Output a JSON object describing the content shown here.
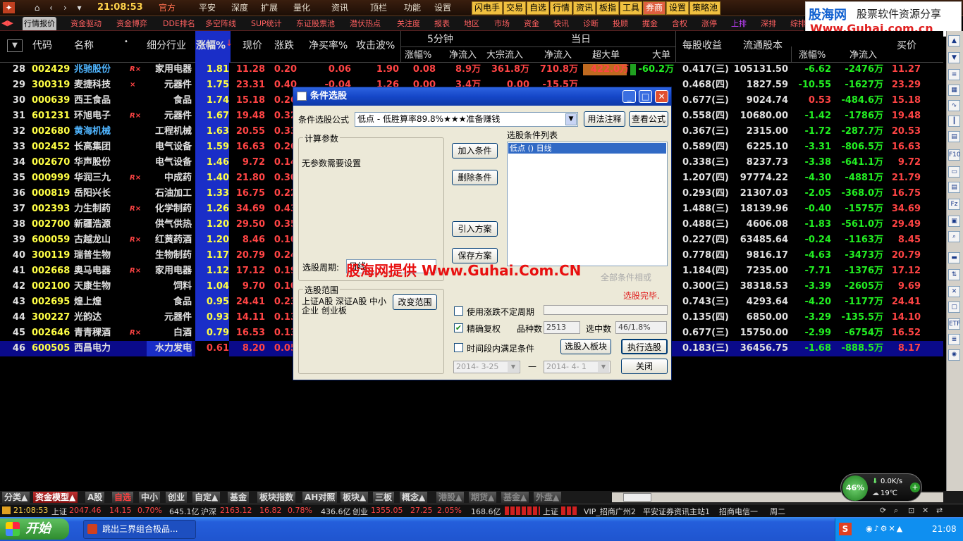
{
  "topbar": {
    "clock": "21:08:53",
    "menu": [
      "官方",
      "平安",
      "深度",
      "扩展",
      "量化",
      "资讯",
      "顶栏",
      "功能",
      "设置"
    ],
    "buttons": [
      "闪电手",
      "交易",
      "自选",
      "行情",
      "资讯",
      "板指",
      "工具",
      "券商",
      "设置",
      "策略池"
    ],
    "logo_top": "股海网",
    "logo_tag": "股票软件资源分享",
    "logo_url": "Www.Guhai.com.cn"
  },
  "tabs": [
    "行情报价",
    "资金驱动",
    "资金博弈",
    "DDE排名",
    "多空阵线",
    "SUP统计",
    "东证股票池",
    "潜伏热点",
    "关注度",
    "报表",
    "地区",
    "市场",
    "资金",
    "快讯",
    "诊断",
    "投顾",
    "掘金",
    "含权",
    "涨停",
    "上排",
    "深排",
    "综排"
  ],
  "header": {
    "code": "代码",
    "name": "名称",
    "industry": "细分行业",
    "pct": "涨幅%",
    "price": "现价",
    "change": "涨跌",
    "net_buy": "净买率%",
    "attack": "攻击波%",
    "five_min": "5分钟",
    "five_pct": "涨幅%",
    "five_flow": "净流入",
    "day": "当日",
    "big_flow": "大宗流入",
    "day_flow": "净流入",
    "super_big": "超大单",
    "big": "大单",
    "eps": "每股收益",
    "float_cap": "流通股本",
    "r_pct": "涨幅%",
    "r_flow": "净流入",
    "buy_price": "买价"
  },
  "rows": [
    {
      "n": "28",
      "code": "002429",
      "name": "兆驰股份",
      "nc": "blu",
      "flag": "R×",
      "ind": "家用电器",
      "pct": "1.81",
      "price": "11.28",
      "chg": "0.20",
      "nb": "0.06",
      "atk": "1.90",
      "fp": "0.08",
      "ff": "8.9万",
      "bf": "361.8万",
      "df": "710.8万",
      "sb": "422.0万",
      "bg": "-60.2万",
      "eps": "0.417(三)",
      "fc": "105131.50",
      "rp": "-6.62",
      "rf": "-2476万",
      "bp": "11.27"
    },
    {
      "n": "29",
      "code": "300319",
      "name": "麦捷科技",
      "nc": "wht",
      "flag": "×",
      "ind": "元器件",
      "pct": "1.75",
      "price": "23.31",
      "chg": "0.40",
      "nb": "",
      "atk": "",
      "fp": "",
      "ff": "",
      "bf": "",
      "df": "",
      "sb": "",
      "bg": "",
      "eps": "0.468(四)",
      "fc": "1827.59",
      "rp": "-10.55",
      "rf": "-1627万",
      "bp": "23.29"
    },
    {
      "n": "30",
      "code": "000639",
      "name": "西王食品",
      "nc": "wht",
      "flag": "",
      "ind": "食品",
      "pct": "1.74",
      "price": "15.18",
      "chg": "0.26",
      "nb": "",
      "atk": "",
      "fp": "",
      "ff": "",
      "bf": "",
      "df": "",
      "sb": "",
      "bg": "",
      "eps": "0.677(三)",
      "fc": "9024.74",
      "rp": "0.53",
      "rf": "-484.6万",
      "bp": "15.18"
    },
    {
      "n": "31",
      "code": "601231",
      "name": "环旭电子",
      "nc": "wht",
      "flag": "R×",
      "ind": "元器件",
      "pct": "1.67",
      "price": "19.48",
      "chg": "0.32",
      "nb": "",
      "atk": "",
      "fp": "",
      "ff": "",
      "bf": "",
      "df": "",
      "sb": "",
      "bg": "",
      "eps": "0.558(四)",
      "fc": "10680.00",
      "rp": "-1.42",
      "rf": "-1786万",
      "bp": "19.48"
    },
    {
      "n": "32",
      "code": "002680",
      "name": "黄海机械",
      "nc": "blu",
      "flag": "",
      "ind": "工程机械",
      "pct": "1.63",
      "price": "20.55",
      "chg": "0.33",
      "nb": "",
      "atk": "",
      "fp": "",
      "ff": "",
      "bf": "",
      "df": "",
      "sb": "",
      "bg": "",
      "eps": "0.367(三)",
      "fc": "2315.00",
      "rp": "-1.72",
      "rf": "-287.7万",
      "bp": "20.53"
    },
    {
      "n": "33",
      "code": "002452",
      "name": "长高集团",
      "nc": "wht",
      "flag": "",
      "ind": "电气设备",
      "pct": "1.59",
      "price": "16.63",
      "chg": "0.26",
      "nb": "",
      "atk": "",
      "fp": "",
      "ff": "",
      "bf": "",
      "df": "",
      "sb": "",
      "bg": "",
      "eps": "0.589(四)",
      "fc": "6225.10",
      "rp": "-3.31",
      "rf": "-806.5万",
      "bp": "16.63"
    },
    {
      "n": "34",
      "code": "002670",
      "name": "华声股份",
      "nc": "wht",
      "flag": "",
      "ind": "电气设备",
      "pct": "1.46",
      "price": "9.72",
      "chg": "0.14",
      "nb": "",
      "atk": "",
      "fp": "",
      "ff": "",
      "bf": "",
      "df": "",
      "sb": "",
      "bg": "",
      "eps": "0.338(三)",
      "fc": "8237.73",
      "rp": "-3.38",
      "rf": "-641.1万",
      "bp": "9.72"
    },
    {
      "n": "35",
      "code": "000999",
      "name": "华润三九",
      "nc": "wht",
      "flag": "R×",
      "ind": "中成药",
      "pct": "1.40",
      "price": "21.80",
      "chg": "0.30",
      "nb": "",
      "atk": "",
      "fp": "",
      "ff": "",
      "bf": "",
      "df": "",
      "sb": "",
      "bg": "",
      "eps": "1.207(四)",
      "fc": "97774.22",
      "rp": "-4.30",
      "rf": "-4881万",
      "bp": "21.79"
    },
    {
      "n": "36",
      "code": "000819",
      "name": "岳阳兴长",
      "nc": "wht",
      "flag": "",
      "ind": "石油加工",
      "pct": "1.33",
      "price": "16.75",
      "chg": "0.22",
      "nb": "",
      "atk": "",
      "fp": "",
      "ff": "",
      "bf": "",
      "df": "",
      "sb": "",
      "bg": "",
      "eps": "0.293(四)",
      "fc": "21307.03",
      "rp": "-2.05",
      "rf": "-368.0万",
      "bp": "16.75"
    },
    {
      "n": "37",
      "code": "002393",
      "name": "力生制药",
      "nc": "wht",
      "flag": "R×",
      "ind": "化学制药",
      "pct": "1.26",
      "price": "34.69",
      "chg": "0.43",
      "nb": "",
      "atk": "",
      "fp": "",
      "ff": "",
      "bf": "",
      "df": "",
      "sb": "",
      "bg": "",
      "eps": "1.488(三)",
      "fc": "18139.96",
      "rp": "-0.40",
      "rf": "-1575万",
      "bp": "34.69"
    },
    {
      "n": "38",
      "code": "002700",
      "name": "新疆浩源",
      "nc": "wht",
      "flag": "",
      "ind": "供气供热",
      "pct": "1.20",
      "price": "29.50",
      "chg": "0.35",
      "nb": "",
      "atk": "",
      "fp": "",
      "ff": "",
      "bf": "",
      "df": "",
      "sb": "",
      "bg": "",
      "eps": "0.488(三)",
      "fc": "4606.08",
      "rp": "-1.83",
      "rf": "-561.0万",
      "bp": "29.49"
    },
    {
      "n": "39",
      "code": "600059",
      "name": "古越龙山",
      "nc": "wht",
      "flag": "R×",
      "ind": "红黄药酒",
      "pct": "1.20",
      "price": "8.46",
      "chg": "0.10",
      "nb": "",
      "atk": "",
      "fp": "",
      "ff": "",
      "bf": "",
      "df": "",
      "sb": "",
      "bg": "",
      "eps": "0.227(四)",
      "fc": "63485.64",
      "rp": "-0.24",
      "rf": "-1163万",
      "bp": "8.45"
    },
    {
      "n": "40",
      "code": "300119",
      "name": "瑞普生物",
      "nc": "wht",
      "flag": "",
      "ind": "生物制药",
      "pct": "1.17",
      "price": "20.79",
      "chg": "0.24",
      "nb": "",
      "atk": "",
      "fp": "",
      "ff": "",
      "bf": "",
      "df": "",
      "sb": "",
      "bg": "",
      "eps": "0.778(四)",
      "fc": "9816.17",
      "rp": "-4.63",
      "rf": "-3473万",
      "bp": "20.79"
    },
    {
      "n": "41",
      "code": "002668",
      "name": "奥马电器",
      "nc": "wht",
      "flag": "R×",
      "ind": "家用电器",
      "pct": "1.12",
      "price": "17.12",
      "chg": "0.19",
      "nb": "",
      "atk": "",
      "fp": "",
      "ff": "",
      "bf": "",
      "df": "",
      "sb": "",
      "bg": "",
      "eps": "1.184(四)",
      "fc": "7235.00",
      "rp": "-7.71",
      "rf": "-1376万",
      "bp": "17.12"
    },
    {
      "n": "42",
      "code": "002100",
      "name": "天康生物",
      "nc": "wht",
      "flag": "",
      "ind": "饲料",
      "pct": "1.04",
      "price": "9.70",
      "chg": "0.10",
      "nb": "",
      "atk": "",
      "fp": "",
      "ff": "",
      "bf": "",
      "df": "",
      "sb": "",
      "bg": "",
      "eps": "0.300(三)",
      "fc": "38318.53",
      "rp": "-3.39",
      "rf": "-2605万",
      "bp": "9.69"
    },
    {
      "n": "43",
      "code": "002695",
      "name": "煌上煌",
      "nc": "wht",
      "flag": "",
      "ind": "食品",
      "pct": "0.95",
      "price": "24.41",
      "chg": "0.23",
      "nb": "",
      "atk": "",
      "fp": "",
      "ff": "",
      "bf": "",
      "df": "",
      "sb": "",
      "bg": "",
      "eps": "0.743(三)",
      "fc": "4293.64",
      "rp": "-4.20",
      "rf": "-1177万",
      "bp": "24.41"
    },
    {
      "n": "44",
      "code": "300227",
      "name": "光韵达",
      "nc": "wht",
      "flag": "",
      "ind": "元器件",
      "pct": "0.93",
      "price": "14.11",
      "chg": "0.13",
      "nb": "",
      "atk": "",
      "fp": "",
      "ff": "",
      "bf": "",
      "df": "",
      "sb": "",
      "bg": "",
      "eps": "0.135(四)",
      "fc": "6850.00",
      "rp": "-3.29",
      "rf": "-135.5万",
      "bp": "14.10"
    },
    {
      "n": "45",
      "code": "002646",
      "name": "青青稞酒",
      "nc": "wht",
      "flag": "R×",
      "ind": "白酒",
      "pct": "0.79",
      "price": "16.53",
      "chg": "0.13",
      "nb": "",
      "atk": "",
      "fp": "",
      "ff": "",
      "bf": "",
      "df": "",
      "sb": "",
      "bg": "",
      "eps": "0.677(三)",
      "fc": "15750.00",
      "rp": "-2.99",
      "rf": "-6754万",
      "bp": "16.52"
    },
    {
      "n": "46",
      "code": "600505",
      "name": "西昌电力",
      "nc": "wht",
      "flag": "",
      "ind": "水力发电",
      "pct": "0.61",
      "price": "8.20",
      "chg": "0.05",
      "nb": "",
      "atk": "",
      "fp": "",
      "ff": "",
      "bf": "",
      "df": "",
      "sb": "",
      "bg": "",
      "eps": "0.183(三)",
      "fc": "36456.75",
      "rp": "-1.68",
      "rf": "-888.5万",
      "bp": "8.17"
    }
  ],
  "row29_extra": {
    "nb": "-0.04",
    "atk": "1.26",
    "fp": "0.00",
    "ff": "3.4万",
    "bf": "0.00",
    "df": "-15.5万"
  },
  "dialog": {
    "title": "条件选股",
    "formula_label": "条件选股公式",
    "formula_value": "低点      - 低胜算率89.8%★★★准备赚钱",
    "usage_btn": "用法注释",
    "view_btn": "查看公式",
    "params_group": "计算参数",
    "params_text": "无参数需要设置",
    "add_btn": "加入条件",
    "delete_btn": "删除条件",
    "import_btn": "引入方案",
    "save_btn": "保存方案",
    "list_label": "选股条件列表",
    "list_items": [
      "低点  ()  日线"
    ],
    "period_label": "选股周期:",
    "period_value": "日线",
    "watermark": "股海网提供 Www.Guhai.Com.CN",
    "faded_text": "全部条件相或",
    "scope_group": "选股范围",
    "scope_text": "上证A股 深证A股 中小企业 创业板",
    "change_scope_btn": "改变范围",
    "done_text": "选股完毕.",
    "chk_period": "使用涨跌不定周期",
    "chk_adjust": "精确复权",
    "count_label": "品种数",
    "count_value": "2513",
    "selected_label": "选中数",
    "selected_value": "46/1.8%",
    "chk_time": "时间段内满足条件",
    "to_block_btn": "选股入板块",
    "execute_btn": "执行选股",
    "close_btn": "关闭",
    "date_from": "2014- 3-25",
    "date_to": "2014- 4- 1",
    "date_sep": "—"
  },
  "bottom_tabs": [
    "分类▲",
    "资金模型▲",
    "A股",
    "自选",
    "中小",
    "创业",
    "自定▲",
    "基金",
    "板块指数",
    "AH对照",
    "板块▲",
    "三板",
    "概念▲",
    "港股▲",
    "期货▲",
    "基金▲",
    "外盘▲"
  ],
  "status": {
    "time": "21:08:53",
    "sh_label": "上证",
    "sh_val": "2047.46",
    "sh_chg": "14.15",
    "sh_pct": "0.70%",
    "sh_amt": "645.1亿",
    "sz_label": "沪深",
    "sz_val": "2163.12",
    "sz_chg": "16.82",
    "sz_pct": "0.78%",
    "sz_amt": "436.6亿",
    "cy_label": "创业",
    "cy_val": "1355.05",
    "cy_chg": "27.25",
    "cy_pct": "2.05%",
    "cy_amt": "168.6亿",
    "board_sh": "上证",
    "vip": "VIP_招商广州2",
    "news": "平安证券资讯主站1",
    "isp": "招商电信一",
    "day": "周二"
  },
  "gauge": {
    "pct": "46%",
    "speed": "0.0K/s",
    "temp": "19℃"
  },
  "taskbar": {
    "start": "开始",
    "task": "跳出三界组合极品...",
    "time": "21:08"
  }
}
